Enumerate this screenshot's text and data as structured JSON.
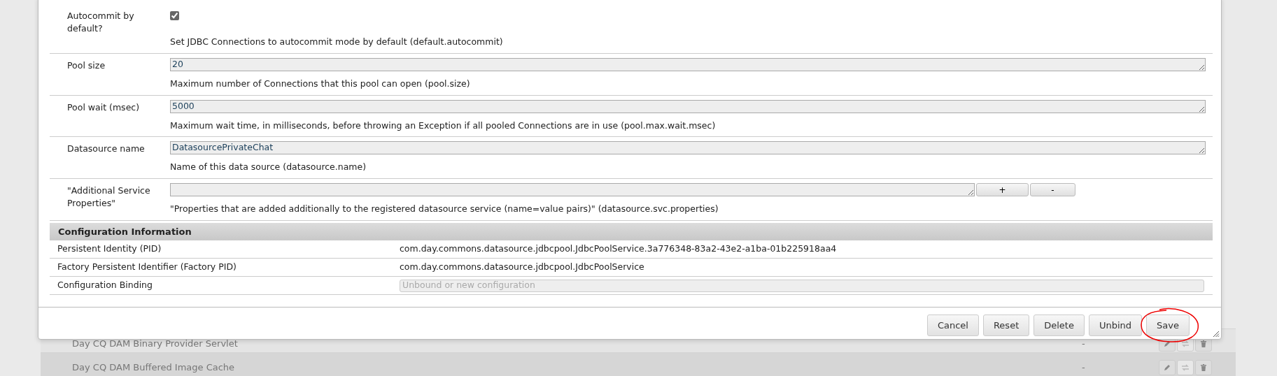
{
  "properties": [
    {
      "kind": "checkbox",
      "label": "Autocommit by default?",
      "checked": true,
      "description": "Set JDBC Connections to autocommit mode by default (default.autocommit)"
    },
    {
      "kind": "text",
      "label": "Pool size",
      "value": "20",
      "description": "Maximum number of Connections that this pool can open (pool.size)"
    },
    {
      "kind": "text",
      "label": "Pool wait (msec)",
      "value": "5000",
      "description": "Maximum wait time, in milliseconds, before throwing an Exception if all pooled Connections are in use (pool.max.wait.msec)"
    },
    {
      "kind": "text",
      "label": "Datasource name",
      "value": "DatasourcePrivateChat",
      "description": "Name of this data source (datasource.name)"
    },
    {
      "kind": "multi",
      "label": "\"Additional Service Properties\"",
      "add": "+",
      "remove": "-",
      "description": "\"Properties that are added additionally to the registered datasource service (name=value pairs)\" (datasource.svc.properties)"
    }
  ],
  "config_info": {
    "title": "Configuration Information",
    "rows": [
      {
        "kind": "text",
        "label": "Persistent Identity (PID)",
        "value": "com.day.commons.datasource.jdbcpool.JdbcPoolService.3a776348-83a2-43e2-a1ba-01b225918aa4"
      },
      {
        "kind": "text",
        "label": "Factory Persistent Identifier (Factory PID)",
        "value": "com.day.commons.datasource.jdbcpool.JdbcPoolService"
      },
      {
        "kind": "field",
        "label": "Configuration Binding",
        "placeholder": "Unbound or new configuration"
      }
    ]
  },
  "buttons": [
    "Cancel",
    "Reset",
    "Delete",
    "Unbind",
    "Save"
  ],
  "background_rows": [
    {
      "name": "Day CQ DAM Binary Provider Servlet",
      "column_2": "-"
    },
    {
      "name": "Day CQ DAM Buffered Image Cache",
      "column_2": "-"
    }
  ]
}
